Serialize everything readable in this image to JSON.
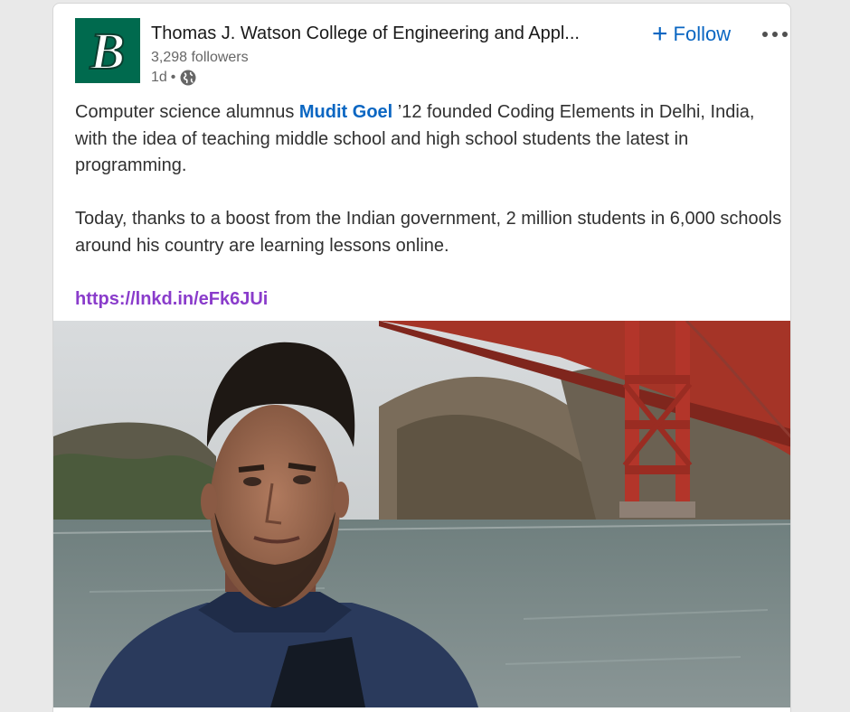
{
  "post": {
    "author": {
      "name": "Thomas J. Watson College of Engineering and Appl...",
      "followers": "3,298 followers",
      "time": "1d",
      "separator": "•",
      "logo_letter": "B",
      "logo_color": "#006a4e"
    },
    "follow_button": {
      "icon": "plus-icon",
      "label": "Follow"
    },
    "more_icon": "more-options-icon",
    "text": {
      "p1_before": "Computer science alumnus ",
      "mention": "Mudit Goel",
      "p1_after": " ’12 founded Coding Elements in Delhi, India, with the idea of teaching middle school and high school students the latest in programming.",
      "p2": "Today, thanks to a boost from the Indian government, 2 million students in 6,000 schools around his country are learning lessons online.",
      "link": "https://lnkd.in/eFk6JUi"
    },
    "image": {
      "subject": "man-in-front-of-golden-gate-bridge"
    },
    "colors": {
      "accent": "#0a66c2",
      "link": "#8a3ccb",
      "bridge": "#b3352a"
    }
  }
}
